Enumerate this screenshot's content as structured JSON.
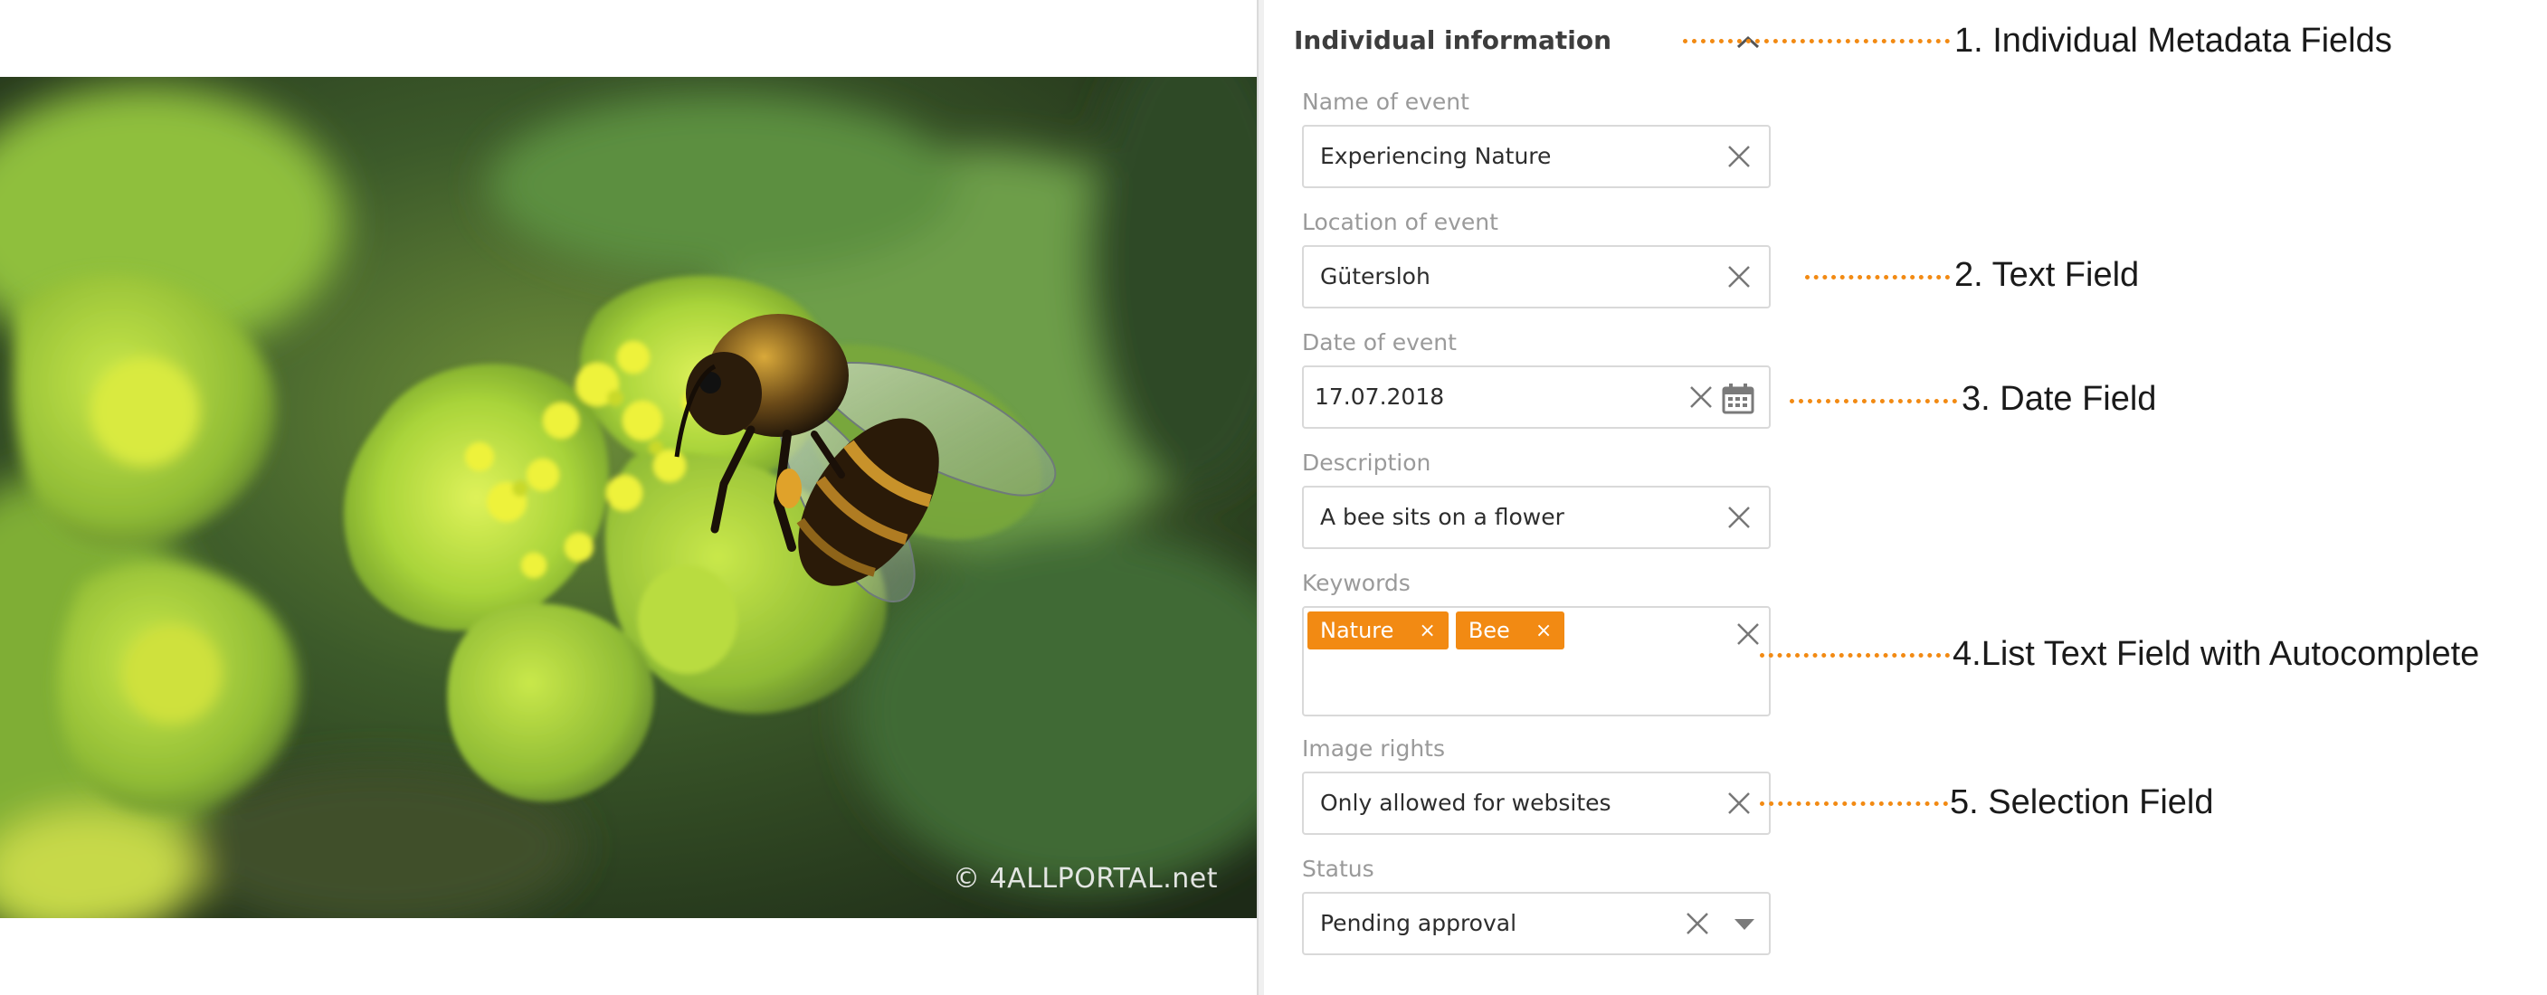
{
  "photo": {
    "watermark": "© 4ALLPORTAL.net"
  },
  "panel": {
    "section_title": "Individual information",
    "fields": {
      "name_of_event": {
        "label": "Name of event",
        "value": "Experiencing Nature"
      },
      "location_of_event": {
        "label": "Location of event",
        "value": "Gütersloh"
      },
      "date_of_event": {
        "label": "Date of event",
        "value": "17.07.2018"
      },
      "description": {
        "label": "Description",
        "value": "A bee sits on a flower"
      },
      "keywords": {
        "label": "Keywords",
        "tags": [
          "Nature",
          "Bee"
        ],
        "tag_remove_glyph": "×"
      },
      "image_rights": {
        "label": "Image rights",
        "value": "Only allowed for websites"
      },
      "status": {
        "label": "Status",
        "value": "Pending approval"
      }
    }
  },
  "annotations": [
    "1. Individual Metadata Fields",
    "2. Text Field",
    "3. Date Field",
    "4.List Text Field with Autocomplete",
    "5. Selection Field"
  ],
  "colors": {
    "accent": "#f28a13",
    "label": "#9a9a9a",
    "text": "#2d2d2d",
    "border": "#d9d9d9"
  }
}
